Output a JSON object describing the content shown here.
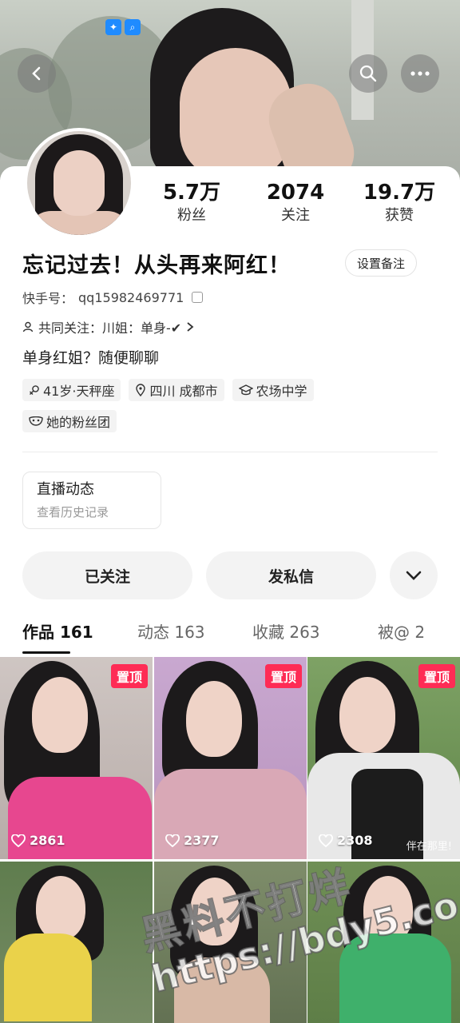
{
  "header": {
    "back_icon": "chevron-left-icon",
    "search_icon": "search-icon",
    "more_icon": "ellipsis-icon",
    "badges": [
      "bulb-icon",
      "search-icon"
    ]
  },
  "profile": {
    "stats": [
      {
        "num": "5.7万",
        "label": "粉丝"
      },
      {
        "num": "2074",
        "label": "关注"
      },
      {
        "num": "19.7万",
        "label": "获赞"
      }
    ],
    "nickname": "忘记过去！从头再来阿红！",
    "note_button": "设置备注",
    "kuaishou_id_label": "快手号：",
    "kuaishou_id": "qq15982469771",
    "mutual_follow": "共同关注：川姐：单身-✔",
    "bio": "单身红姐？随便聊聊",
    "tags": [
      {
        "icon": "gender-icon",
        "text": "41岁·天秤座"
      },
      {
        "icon": "location-icon",
        "text": "四川 成都市"
      },
      {
        "icon": "school-icon",
        "text": "农场中学"
      }
    ],
    "fan_group": {
      "icon": "mask-icon",
      "text": "她的粉丝团"
    }
  },
  "live_card": {
    "title": "直播动态",
    "subtitle": "查看历史记录"
  },
  "actions": {
    "follow": "已关注",
    "message": "发私信",
    "more_icon": "chevron-down-icon"
  },
  "tabs": [
    {
      "label": "作品 161",
      "active": true
    },
    {
      "label": "动态 163",
      "active": false
    },
    {
      "label": "收藏 263",
      "active": false
    },
    {
      "label": "被@ 2",
      "active": false
    }
  ],
  "grid": [
    {
      "pinned": "置顶",
      "likes": "2861"
    },
    {
      "pinned": "置顶",
      "likes": "2377"
    },
    {
      "pinned": "置顶",
      "likes": "2308",
      "caption": "伴在那里!"
    },
    {
      "likes": ""
    },
    {
      "likes": ""
    },
    {
      "likes": ""
    }
  ],
  "watermark": {
    "line1": "黑料不打烊",
    "line2": "https://bdy5.co"
  },
  "colors": {
    "pin_red": "#fe2c55",
    "pill_bg": "#f3f3f3"
  }
}
